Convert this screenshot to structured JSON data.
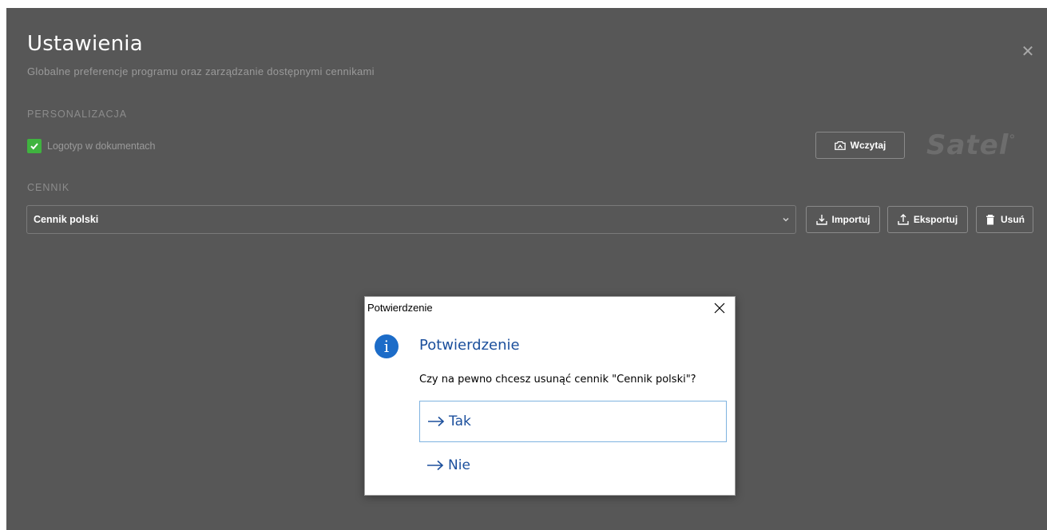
{
  "settings": {
    "title": "Ustawienia",
    "subtitle": "Globalne preferencje programu oraz zarządzanie dostępnymi cennikami",
    "close_symbol": "✕",
    "personalization": {
      "section_label": "PERSONALIZACJA",
      "logo_checkbox_label": "Logotyp w dokumentach",
      "logo_checkbox_checked": true,
      "load_button_label": "Wczytaj",
      "brand_logo_text": "Satel"
    },
    "pricelist": {
      "section_label": "CENNIK",
      "selected_value": "Cennik polski",
      "import_label": "Importuj",
      "export_label": "Eksportuj",
      "delete_label": "Usuń"
    }
  },
  "dialog": {
    "window_title": "Potwierdzenie",
    "heading": "Potwierdzenie",
    "message": "Czy na pewno chcesz usunąć cennik \"Cennik polski\"?",
    "info_symbol": "i",
    "options": [
      {
        "label": "Tak",
        "focused": true
      },
      {
        "label": "Nie",
        "focused": false
      }
    ]
  },
  "colors": {
    "panel_bg": "#575757",
    "checkbox_green": "#3fb33f",
    "dialog_accent": "#1b4f9c",
    "info_icon": "#1c6cc8"
  }
}
